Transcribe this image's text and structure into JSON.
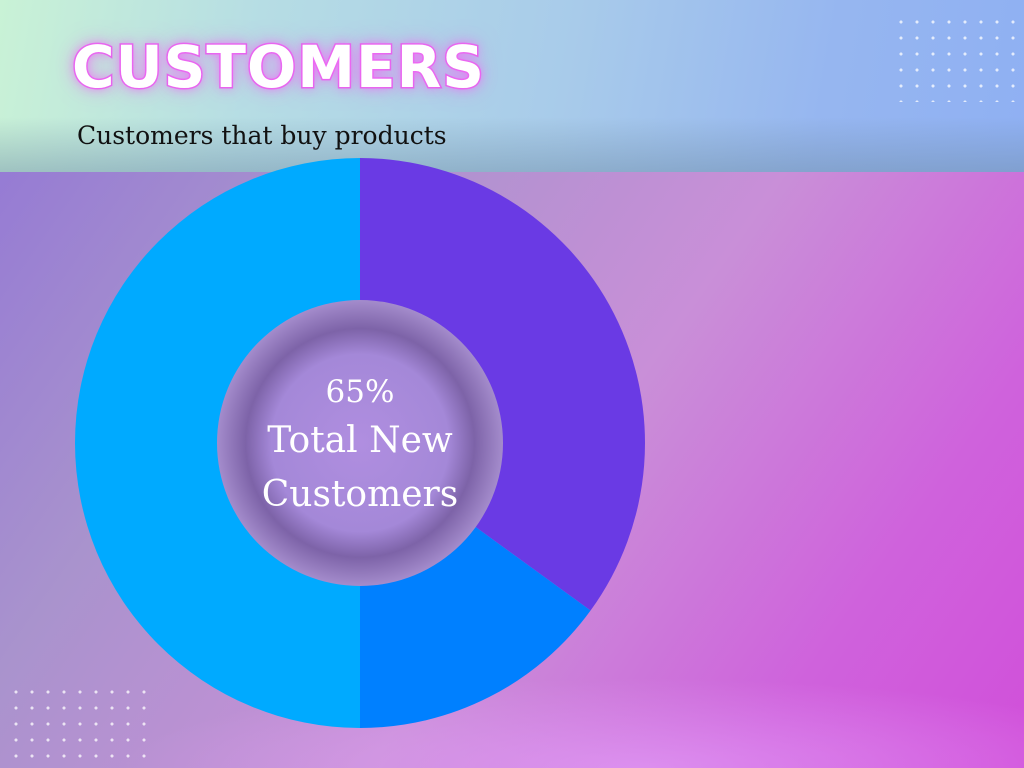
{
  "title": "CUSTOMERS",
  "subtitle": "Customers that buy products",
  "colors": {
    "header_band_start": "#c9f2d6",
    "header_band_end": "#8fb0f3",
    "background_start": "#8f73d6",
    "background_end": "#d14fda",
    "title_glow": "#e561ec"
  },
  "chart_data": {
    "type": "pie",
    "variant": "donut",
    "center_value": "65%",
    "center_label": "Total New Customers",
    "slices": [
      {
        "value": 35,
        "color": "#6a3ae4"
      },
      {
        "value": 15,
        "color": "#0080ff"
      },
      {
        "value": 50,
        "color": "#00aaff"
      }
    ],
    "start": "top",
    "direction": "clockwise",
    "legend": "none"
  }
}
